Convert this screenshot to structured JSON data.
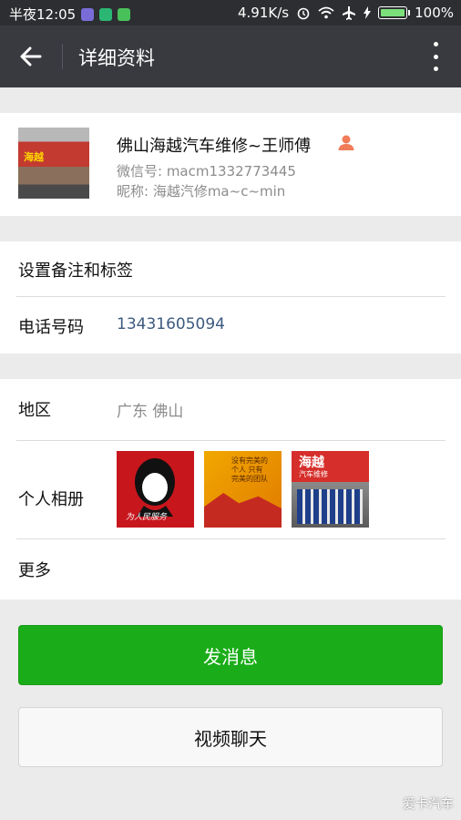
{
  "status_bar": {
    "time": "半夜12:05",
    "network_speed": "4.91K/s",
    "battery": "100%"
  },
  "header": {
    "title": "详细资料"
  },
  "profile": {
    "name": "佛山海越汽车维修~王师傅",
    "wechat_id": "微信号: macm1332773445",
    "nickname": "昵称: 海越汽修ma~c~min",
    "avatar_sign_text": "海越"
  },
  "section_remark": {
    "label": "设置备注和标签"
  },
  "section_phone": {
    "label": "电话号码",
    "value": "13431605094"
  },
  "section_region": {
    "label": "地区",
    "value": "广东  佛山"
  },
  "section_album": {
    "label": "个人相册",
    "photo1_caption": "为人民服务",
    "photo2_caption": "没有完美的个人 只有完美的团队",
    "photo3_sign": "海越",
    "photo3_sub": "汽车维修"
  },
  "section_more": {
    "label": "更多"
  },
  "buttons": {
    "send_message": "发消息",
    "video_chat": "视频聊天"
  },
  "watermark": "爱卡汽车",
  "colors": {
    "primary_green": "#1aad19",
    "title_bar": "#393a3f",
    "link_blue": "#3d5a80"
  }
}
